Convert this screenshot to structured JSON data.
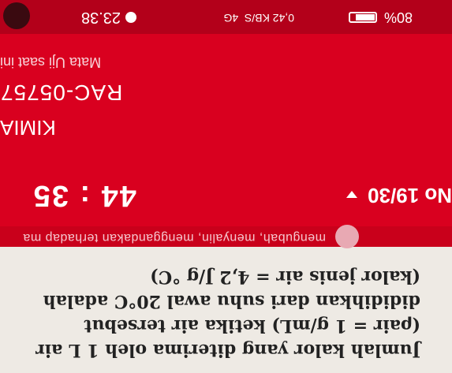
{
  "status_bar": {
    "time": "23.38",
    "network": "0,42 KB/S",
    "signal": "4G",
    "battery_percent": "80%",
    "battery_level": 0.8
  },
  "header": {
    "caption": "Mata Uji saat ini",
    "exam_code": "RAC-05757",
    "subject": "KIMIA"
  },
  "nav": {
    "timer": "44 : 35",
    "question_number": "No 19/30"
  },
  "banner": {
    "text": "mengubah, menyalin, menggandakan terhadap ma"
  },
  "question": {
    "lines": [
      "Jumlah kalor yang diterima oleh 1 L air",
      "(ρair = 1 g/mL) ketika air tersebut",
      "dididihkan dari suhu awal 20°C adalah",
      "(kalor jenis air = 4,2 J/g °C)"
    ]
  },
  "colors": {
    "primary_red": "#d9001f",
    "paper": "#eeeae4"
  }
}
